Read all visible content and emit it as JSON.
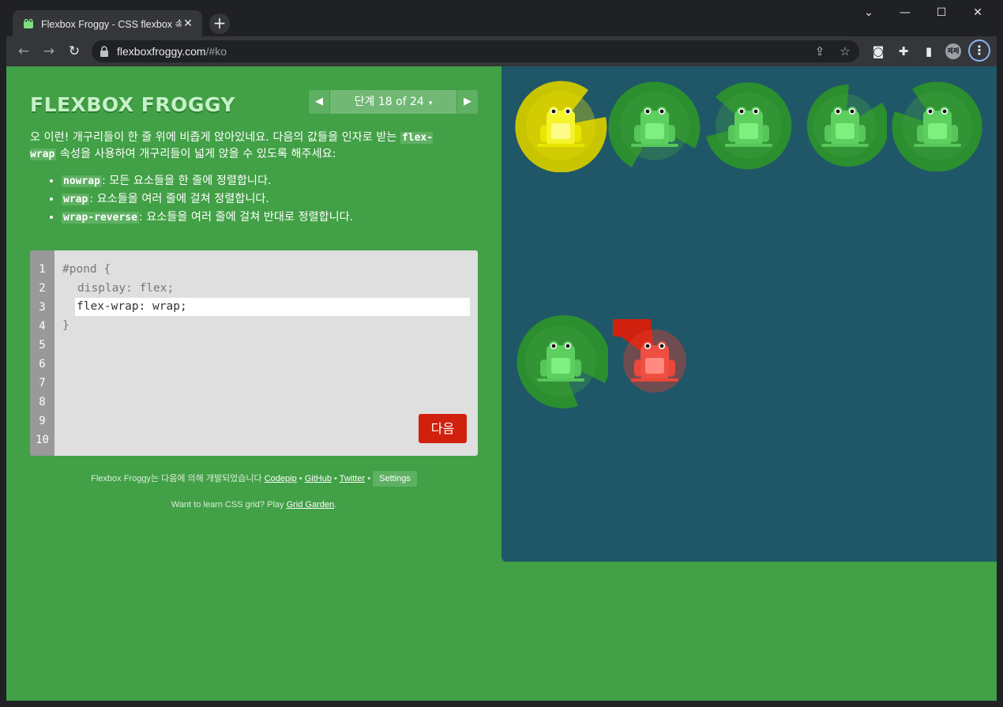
{
  "browser": {
    "tab_title": "Flexbox Froggy - CSS flexbox 속",
    "tab_close": "✕",
    "new_tab": "+",
    "url_host": "flexboxfroggy.com",
    "url_path": "/#ko",
    "profile_initials": "페페",
    "controls": {
      "collapse": "⌄",
      "minimize": "—",
      "maximize": "☐",
      "close": "✕"
    }
  },
  "header": {
    "logo": "FLEXBOX FROGGY",
    "level_indicator": "단계 18 of 24",
    "prev_arrow": "◀",
    "next_arrow": "▶",
    "caret": "▾"
  },
  "instructions": {
    "intro_1": "오 이런! 개구리들이 한 줄 위에 비좁게 앉아있네요. 다음의 값들을 인자로 받는 ",
    "property": "flex-wrap",
    "intro_2": " 속성을 사용하여 개구리들이 넓게 앉을 수 있도록 해주세요:",
    "options": [
      {
        "value": "nowrap",
        "desc": ": 모든 요소들을 한 줄에 정렬합니다."
      },
      {
        "value": "wrap",
        "desc": ": 요소들을 여러 줄에 걸쳐 정렬합니다."
      },
      {
        "value": "wrap-reverse",
        "desc": ": 요소들을 여러 줄에 걸쳐 반대로 정렬합니다."
      }
    ]
  },
  "editor": {
    "line_numbers": [
      "1",
      "2",
      "3",
      "4",
      "5",
      "6",
      "7",
      "8",
      "9",
      "10"
    ],
    "line1": "#pond {",
    "line2": "display: flex;",
    "input_value": "flex-wrap: wrap;",
    "line4": "}",
    "next_button": "다음"
  },
  "footer": {
    "credits_prefix": "Flexbox Froggy는 다음에 의해 개발되었습니다",
    "codepip": "Codepip",
    "github": "GitHub",
    "twitter": "Twitter",
    "separator": "•",
    "settings": "Settings",
    "grid_prefix": "Want to learn CSS grid? Play ",
    "grid_link": "Grid Garden",
    "grid_suffix": "."
  },
  "pond": {
    "frogs": [
      {
        "color": "yellow"
      },
      {
        "color": "green"
      },
      {
        "color": "green"
      },
      {
        "color": "green"
      },
      {
        "color": "green"
      },
      {
        "color": "green"
      },
      {
        "color": "red"
      }
    ],
    "colors": {
      "water": "#1f5768",
      "green_pad": "#2b8e2f",
      "green_pad_light": "#3fa143",
      "yellow_pad": "#c9c400",
      "yellow_pad_light": "#e2dc0a",
      "red_pad": "#d0210f",
      "red_pad_light": "#e83c2a"
    }
  }
}
